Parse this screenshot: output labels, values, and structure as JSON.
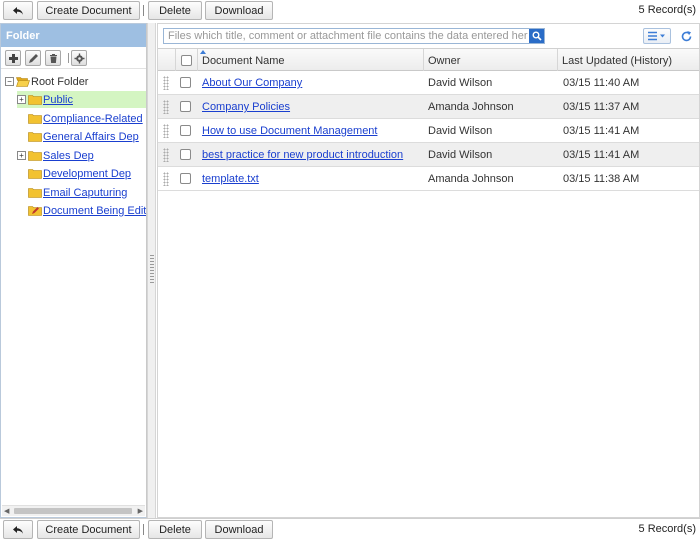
{
  "toolbar": {
    "create_label": "Create Document",
    "delete_label": "Delete",
    "download_label": "Download",
    "records": "5 Record(s)"
  },
  "folder_panel": {
    "title": "Folder",
    "tools": [
      "add-icon",
      "pencil-icon",
      "trash-icon",
      "gear-icon"
    ],
    "tree": {
      "root": "Root Folder",
      "items": [
        {
          "label": "Public",
          "expandable": true,
          "selected": true
        },
        {
          "label": "Compliance-Related",
          "expandable": false
        },
        {
          "label": "General Affairs Dep",
          "expandable": false
        },
        {
          "label": "Sales Dep",
          "expandable": true
        },
        {
          "label": "Development Dep",
          "expandable": false
        },
        {
          "label": "Email Caputuring",
          "expandable": false
        },
        {
          "label": "Document Being Edited",
          "expandable": false
        }
      ]
    }
  },
  "search": {
    "placeholder": "Files which title, comment or attachment file contains the data entered here are ..."
  },
  "grid": {
    "columns": {
      "name": "Document Name",
      "owner": "Owner",
      "updated": "Last Updated (History)"
    },
    "rows": [
      {
        "name": "About Our Company",
        "owner": "David Wilson",
        "updated": "03/15 11:40 AM"
      },
      {
        "name": "Company Policies",
        "owner": "Amanda Johnson",
        "updated": "03/15 11:37 AM"
      },
      {
        "name": "How to use Document Management",
        "owner": "David Wilson",
        "updated": "03/15 11:41 AM"
      },
      {
        "name": "best practice for new product introduction",
        "owner": "David Wilson",
        "updated": "03/15 11:41 AM"
      },
      {
        "name": "template.txt",
        "owner": "Amanda Johnson",
        "updated": "03/15 11:38 AM"
      }
    ]
  },
  "colors": {
    "panel_header": "#9ebfe2",
    "selected_node": "#d4f5c2",
    "link": "#1a3fcf",
    "folder": "#f2c230"
  }
}
